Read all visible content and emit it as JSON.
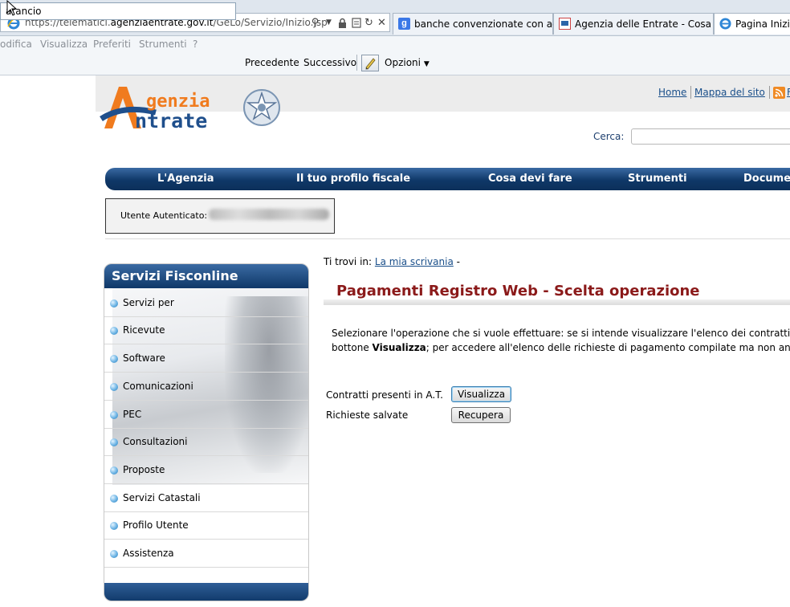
{
  "browser": {
    "url_prefix": "https://telematici.",
    "url_domain": "agenziaentrate.gov.it",
    "url_path": "/GeLo/Servizio/Inizio.jsp",
    "tabs": [
      {
        "label": "banche convenzionate con ag..."
      },
      {
        "label": "Agenzia delle Entrate - Cosa de..."
      },
      {
        "label": "Pagina Iniziale"
      }
    ],
    "menu": [
      "odifica",
      "Visualizza",
      "Preferiti",
      "Strumenti",
      "?"
    ],
    "find": {
      "value": "arancio",
      "prev": "Precedente",
      "next": "Successivo",
      "options": "Opzioni"
    }
  },
  "site": {
    "logo_top": "genzia",
    "logo_bottom": "ntrate",
    "top_links": [
      "Home",
      "Mappa del sito"
    ],
    "search_label": "Cerca:",
    "nav": [
      "L'Agenzia",
      "Il tuo profilo fiscale",
      "Cosa devi fare",
      "Strumenti",
      "Documen"
    ],
    "user_label": "Utente Autenticato:"
  },
  "sidebar": {
    "title": "Servizi Fisconline",
    "items": [
      "Servizi per",
      "Ricevute",
      "Software",
      "Comunicazioni",
      "PEC",
      "Consultazioni",
      "Proposte",
      "Servizi Catastali",
      "Profilo Utente",
      "Assistenza"
    ]
  },
  "main": {
    "crumb_prefix": "Ti trovi in:",
    "crumb_link": "La mia scrivania",
    "crumb_suffix": "-",
    "title": "Pagamenti Registro Web - Scelta operazione",
    "intro_line1": "Selezionare l'operazione che si vuole effettuare: se si intende visualizzare l'elenco dei contratti",
    "intro_line2a": "bottone ",
    "intro_line2b": "Visualizza",
    "intro_line2c": "; per accedere all'elenco delle richieste di pagamento compilate ma non an",
    "row1_label": "Contratti presenti in A.T.",
    "row1_button": "Visualizza",
    "row2_label": "Richieste salvate",
    "row2_button": "Recupera"
  }
}
